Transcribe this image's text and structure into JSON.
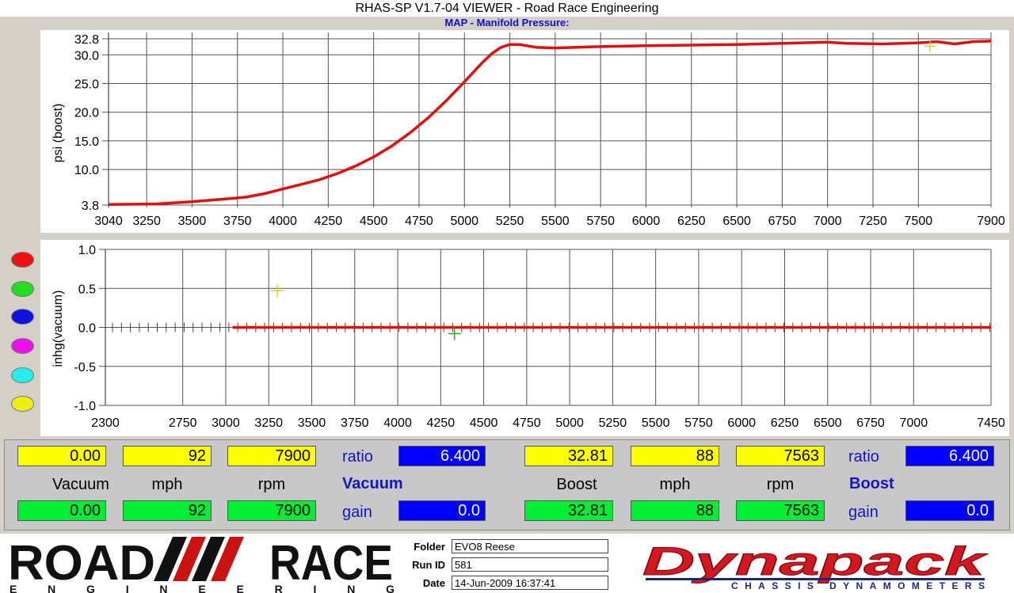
{
  "window_title": "RHAS-SP V1.7-04  VIEWER - Road Race Engineering",
  "chart_title": "MAP - Manifold Pressure:",
  "chart_data": [
    {
      "type": "line",
      "title": "MAP - Manifold Pressure:",
      "ylabel": "psi (boost)",
      "xlabel": "",
      "xlim": [
        3040,
        7900
      ],
      "ylim": [
        3.8,
        32.8
      ],
      "x_ticks": [
        3040,
        3250,
        3500,
        3750,
        4000,
        4250,
        4500,
        4750,
        5000,
        5250,
        5500,
        5750,
        6000,
        6250,
        6500,
        6750,
        7000,
        7250,
        7500,
        7900
      ],
      "y_ticks": [
        3.8,
        10.0,
        15.0,
        20.0,
        25.0,
        30.0,
        32.8
      ],
      "grid": true,
      "series": [
        {
          "color": "#e01010",
          "x": [
            3040,
            3300,
            3500,
            3700,
            3800,
            3900,
            4000,
            4100,
            4200,
            4300,
            4400,
            4500,
            4600,
            4700,
            4800,
            4900,
            5000,
            5050,
            5100,
            5150,
            5200,
            5250,
            5300,
            5400,
            5500,
            5700,
            6000,
            6500,
            7000,
            7100,
            7300,
            7500,
            7600,
            7700,
            7800,
            7900
          ],
          "y": [
            3.9,
            4.0,
            4.4,
            4.9,
            5.2,
            5.8,
            6.6,
            7.4,
            8.2,
            9.3,
            10.6,
            12.2,
            14.1,
            16.4,
            19.0,
            22.0,
            25.3,
            27.0,
            28.7,
            30.2,
            31.3,
            31.8,
            31.8,
            31.3,
            31.2,
            31.4,
            31.6,
            31.8,
            32.2,
            32.0,
            31.9,
            32.1,
            32.3,
            31.9,
            32.3,
            32.4
          ]
        }
      ],
      "cursor_rpm": 7563,
      "cursor_color": "#e0d020"
    },
    {
      "type": "line",
      "title": "",
      "ylabel": "inhg(vacuum)",
      "xlabel": "",
      "xlim": [
        2300,
        7450
      ],
      "ylim": [
        -1.0,
        1.0
      ],
      "x_ticks": [
        2300,
        2750,
        3000,
        3250,
        3500,
        3750,
        4000,
        4250,
        4500,
        4750,
        5000,
        5250,
        5500,
        5750,
        6000,
        6250,
        6500,
        6750,
        7000,
        7450
      ],
      "y_ticks": [
        1.0,
        0.5,
        0.0,
        -0.5,
        -1.0
      ],
      "grid": true,
      "series": [
        {
          "color": "#e01010",
          "x": [
            3040,
            7450
          ],
          "y": [
            0.0,
            0.0
          ]
        }
      ],
      "markers": [
        {
          "x": 3300,
          "y": 0.47,
          "color": "#e0d020"
        },
        {
          "x": 4330,
          "y": -0.08,
          "color": "#20b020"
        }
      ]
    }
  ],
  "color_selectors": [
    {
      "color": "#ee1111",
      "name": "red"
    },
    {
      "color": "#22dd22",
      "name": "green"
    },
    {
      "color": "#1111dd",
      "name": "blue"
    },
    {
      "color": "#ee11ee",
      "name": "magenta"
    },
    {
      "color": "#22eeee",
      "name": "cyan"
    },
    {
      "color": "#eeee11",
      "name": "yellow"
    }
  ],
  "panel": {
    "vacuum": {
      "cursor_value": "0.00",
      "cursor_mph": "92",
      "cursor_rpm": "7900",
      "value_label": "Vacuum",
      "mph_label": "mph",
      "rpm_label": "rpm",
      "value": "0.00",
      "mph": "92",
      "rpm": "7900",
      "ratio_label": "ratio",
      "ratio": "6.400",
      "section_label": "Vacuum",
      "gain_label": "gain",
      "gain": "0.0"
    },
    "boost": {
      "cursor_value": "32.81",
      "cursor_mph": "88",
      "cursor_rpm": "7563",
      "value_label": "Boost",
      "mph_label": "mph",
      "rpm_label": "rpm",
      "value": "32.81",
      "mph": "88",
      "rpm": "7563",
      "ratio_label": "ratio",
      "ratio": "6.400",
      "section_label": "Boost",
      "gain_label": "gain",
      "gain": "0.0"
    }
  },
  "footer": {
    "logo_left": "ROAD RACE",
    "logo_left_sub": "ENGINEERING",
    "folder_label": "Folder",
    "folder": "EVO8 Reese",
    "runid_label": "Run ID",
    "runid": "581",
    "date_label": "Date",
    "date": "14-Jun-2009  16:37:41",
    "logo_right": "Dynapack",
    "logo_right_sub": "CHASSIS DYNAMOMETERS"
  }
}
